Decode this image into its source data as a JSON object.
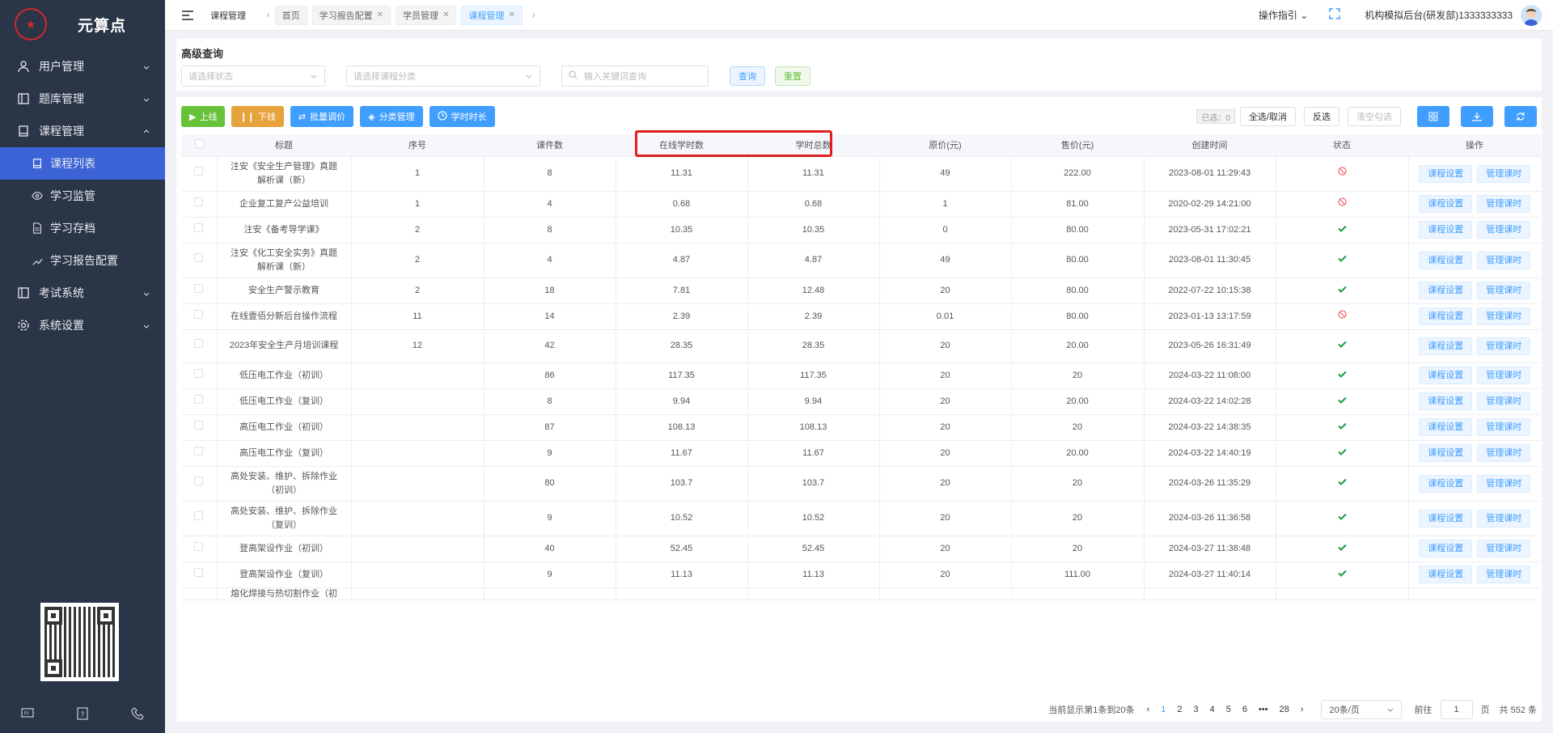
{
  "app": {
    "title": "元算点"
  },
  "sidebar": {
    "menu": [
      {
        "label": "用户管理",
        "icon": "user-icon"
      },
      {
        "label": "题库管理",
        "icon": "question-bank-icon"
      },
      {
        "label": "课程管理",
        "icon": "book-icon",
        "expanded": true
      }
    ],
    "course_sub": [
      {
        "label": "课程列表",
        "icon": "course-list-icon",
        "active": true
      },
      {
        "label": "学习监管",
        "icon": "eye-icon"
      },
      {
        "label": "学习存档",
        "icon": "archive-icon"
      },
      {
        "label": "学习报告配置",
        "icon": "report-config-icon"
      }
    ],
    "menu_after": [
      {
        "label": "考试系统",
        "icon": "exam-icon"
      },
      {
        "label": "系统设置",
        "icon": "gear-icon"
      }
    ]
  },
  "topbar": {
    "breadcrumb": "课程管理",
    "tabs": [
      {
        "label": "首页",
        "closable": false
      },
      {
        "label": "学习报告配置",
        "closable": true
      },
      {
        "label": "学员管理",
        "closable": true
      },
      {
        "label": "课程管理",
        "closable": true,
        "active": true
      }
    ],
    "guide": "操作指引",
    "org": "机构模拟后台(研发部)1333333333"
  },
  "search": {
    "title": "高级查询",
    "status_placeholder": "请选择状态",
    "category_placeholder": "请选择课程分类",
    "keyword_placeholder": "输入关键词查询",
    "query_label": "查询",
    "reset_label": "重置"
  },
  "toolbar": {
    "online": "上线",
    "offline": "下线",
    "batch_price": "批量调价",
    "category_manage": "分类管理",
    "duration": "学时时长",
    "selected": "已选：0",
    "select_all": "全选/取消",
    "invert": "反选",
    "clear": "清空勾选"
  },
  "table": {
    "headers": [
      "标题",
      "序号",
      "课件数",
      "在线学时数",
      "学时总数",
      "原价(元)",
      "售价(元)",
      "创建时间",
      "状态",
      "操作"
    ],
    "op_labels": [
      "课程设置",
      "管理课时"
    ],
    "rows": [
      {
        "title": "注安《安全生产管理》真题解析课（新）",
        "seq": "1",
        "count": "8",
        "online": "11.31",
        "total": "11.31",
        "price": "49",
        "sale": "222.00",
        "created": "2023-08-01 11:29:43",
        "status": "off"
      },
      {
        "title": "企业复工复产公益培训",
        "seq": "1",
        "count": "4",
        "online": "0.68",
        "total": "0.68",
        "price": "1",
        "sale": "81.00",
        "created": "2020-02-29 14:21:00",
        "status": "off"
      },
      {
        "title": "注安《备考导学课》",
        "seq": "2",
        "count": "8",
        "online": "10.35",
        "total": "10.35",
        "price": "0",
        "sale": "80.00",
        "created": "2023-05-31 17:02:21",
        "status": "on"
      },
      {
        "title": "注安《化工安全实务》真题解析课（新）",
        "seq": "2",
        "count": "4",
        "online": "4.87",
        "total": "4.87",
        "price": "49",
        "sale": "80.00",
        "created": "2023-08-01 11:30:45",
        "status": "on"
      },
      {
        "title": "安全生产警示教育",
        "seq": "2",
        "count": "18",
        "online": "7.81",
        "total": "12.48",
        "price": "20",
        "sale": "80.00",
        "created": "2022-07-22 10:15:38",
        "status": "on"
      },
      {
        "title": "在线壹佰分新后台操作流程",
        "seq": "11",
        "count": "14",
        "online": "2.39",
        "total": "2.39",
        "price": "0.01",
        "sale": "80.00",
        "created": "2023-01-13 13:17:59",
        "status": "off"
      },
      {
        "title": "2023年安全生产月培训课程",
        "seq": "12",
        "count": "42",
        "online": "28.35",
        "total": "28.35",
        "price": "20",
        "sale": "20.00",
        "created": "2023-05-26 16:31:49",
        "status": "on"
      },
      {
        "title": "低压电工作业（初训）",
        "seq": "",
        "count": "86",
        "online": "117.35",
        "total": "117.35",
        "price": "20",
        "sale": "20",
        "created": "2024-03-22 11:08:00",
        "status": "on"
      },
      {
        "title": "低压电工作业（复训）",
        "seq": "",
        "count": "8",
        "online": "9.94",
        "total": "9.94",
        "price": "20",
        "sale": "20.00",
        "created": "2024-03-22 14:02:28",
        "status": "on"
      },
      {
        "title": "高压电工作业（初训）",
        "seq": "",
        "count": "87",
        "online": "108.13",
        "total": "108.13",
        "price": "20",
        "sale": "20",
        "created": "2024-03-22 14:38:35",
        "status": "on"
      },
      {
        "title": "高压电工作业（复训）",
        "seq": "",
        "count": "9",
        "online": "11.67",
        "total": "11.67",
        "price": "20",
        "sale": "20.00",
        "created": "2024-03-22 14:40:19",
        "status": "on"
      },
      {
        "title": "高处安装、维护、拆除作业（初训）",
        "seq": "",
        "count": "80",
        "online": "103.7",
        "total": "103.7",
        "price": "20",
        "sale": "20",
        "created": "2024-03-26 11:35:29",
        "status": "on"
      },
      {
        "title": "高处安装、维护、拆除作业（复训）",
        "seq": "",
        "count": "9",
        "online": "10.52",
        "total": "10.52",
        "price": "20",
        "sale": "20",
        "created": "2024-03-26 11:36:58",
        "status": "on"
      },
      {
        "title": "登高架设作业（初训）",
        "seq": "",
        "count": "40",
        "online": "52.45",
        "total": "52.45",
        "price": "20",
        "sale": "20",
        "created": "2024-03-27 11:38:48",
        "status": "on"
      },
      {
        "title": "登高架设作业（复训）",
        "seq": "",
        "count": "9",
        "online": "11.13",
        "total": "11.13",
        "price": "20",
        "sale": "111.00",
        "created": "2024-03-27 11:40:14",
        "status": "on"
      }
    ],
    "partial_row_title": "熔化焊接与热切割作业（初"
  },
  "pagination": {
    "summary": "当前显示第1条到20条",
    "pages": [
      "1",
      "2",
      "3",
      "4",
      "5",
      "6",
      "28"
    ],
    "ellipsis": "•••",
    "page_size": "20条/页",
    "goto_prefix": "前往",
    "goto_value": "1",
    "goto_suffix": "页",
    "total": "共 552 条"
  },
  "colors": {
    "sidebar_bg": "#2b3548",
    "active_blue": "#3b63d6",
    "primary": "#409eff",
    "success": "#67c23a",
    "warning": "#e6a23c",
    "danger": "#f56c6c",
    "highlight": "#e02020"
  }
}
